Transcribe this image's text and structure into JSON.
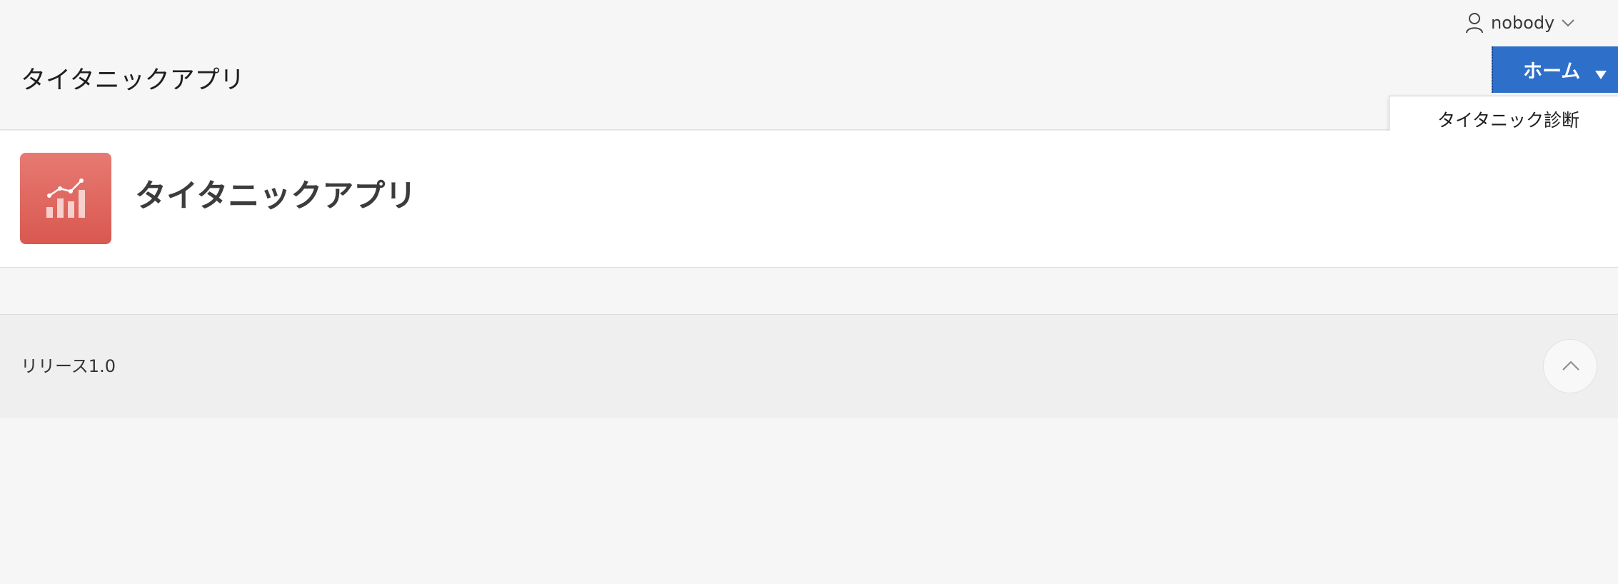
{
  "header": {
    "app_title": "タイタニックアプリ",
    "user": {
      "name": "nobody",
      "icon": "user-icon",
      "chevron": "chevron-down-icon"
    }
  },
  "nav": {
    "home_label": "ホーム",
    "home_caret": "caret-down-icon",
    "dropdown_items": [
      {
        "label": "タイタニック診断"
      }
    ]
  },
  "hero": {
    "icon": "chart-icon",
    "title": "タイタニックアプリ"
  },
  "footer": {
    "release": "リリース1.0",
    "to_top_icon": "chevron-up-icon"
  },
  "colors": {
    "nav_active": "#2e6fc9",
    "hero_icon_bg": "#dd6058",
    "page_bg": "#f6f6f6"
  }
}
